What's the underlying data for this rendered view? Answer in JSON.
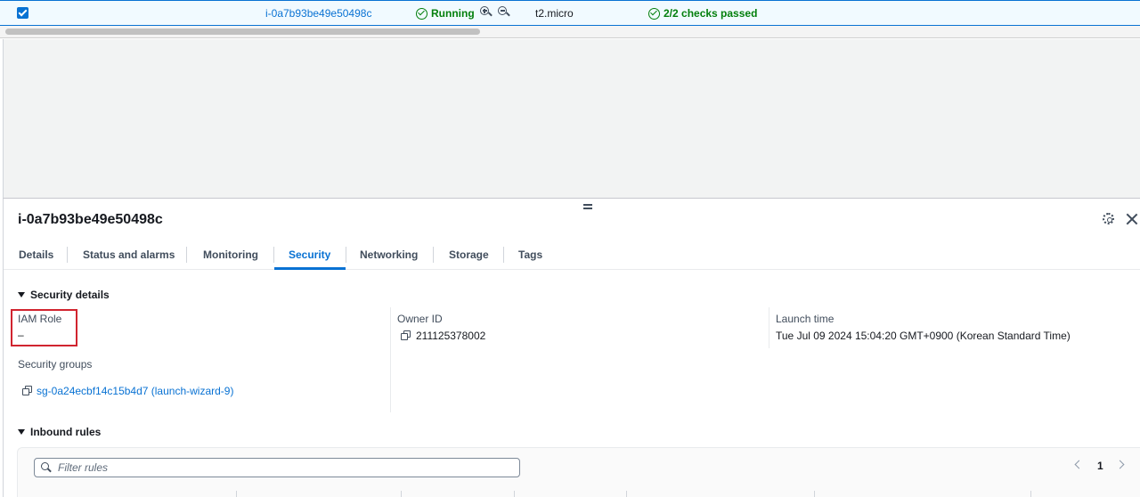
{
  "instance_row": {
    "instance_id": "i-0a7b93be49e50498c",
    "state": "Running",
    "instance_type": "t2.micro",
    "status_check": "2/2 checks passed"
  },
  "split_panel": {
    "title": "i-0a7b93be49e50498c",
    "tabs": [
      {
        "label": "Details"
      },
      {
        "label": "Status and alarms"
      },
      {
        "label": "Monitoring"
      },
      {
        "label": "Security"
      },
      {
        "label": "Networking"
      },
      {
        "label": "Storage"
      },
      {
        "label": "Tags"
      }
    ],
    "active_tab": "Security"
  },
  "security_details": {
    "heading": "Security details",
    "iam_role_label": "IAM Role",
    "iam_role_value": "–",
    "owner_id_label": "Owner ID",
    "owner_id_value": "211125378002",
    "launch_time_label": "Launch time",
    "launch_time_value": "Tue Jul 09 2024 15:04:20 GMT+0900 (Korean Standard Time)",
    "security_groups_label": "Security groups",
    "security_group_link": "sg-0a24ecbf14c15b4d7 (launch-wizard-9)"
  },
  "inbound_rules": {
    "heading": "Inbound rules",
    "filter_placeholder": "Filter rules",
    "page_number": "1"
  },
  "colors": {
    "accent": "#0972d3",
    "success": "#037f0c",
    "highlight": "#d1242f"
  }
}
